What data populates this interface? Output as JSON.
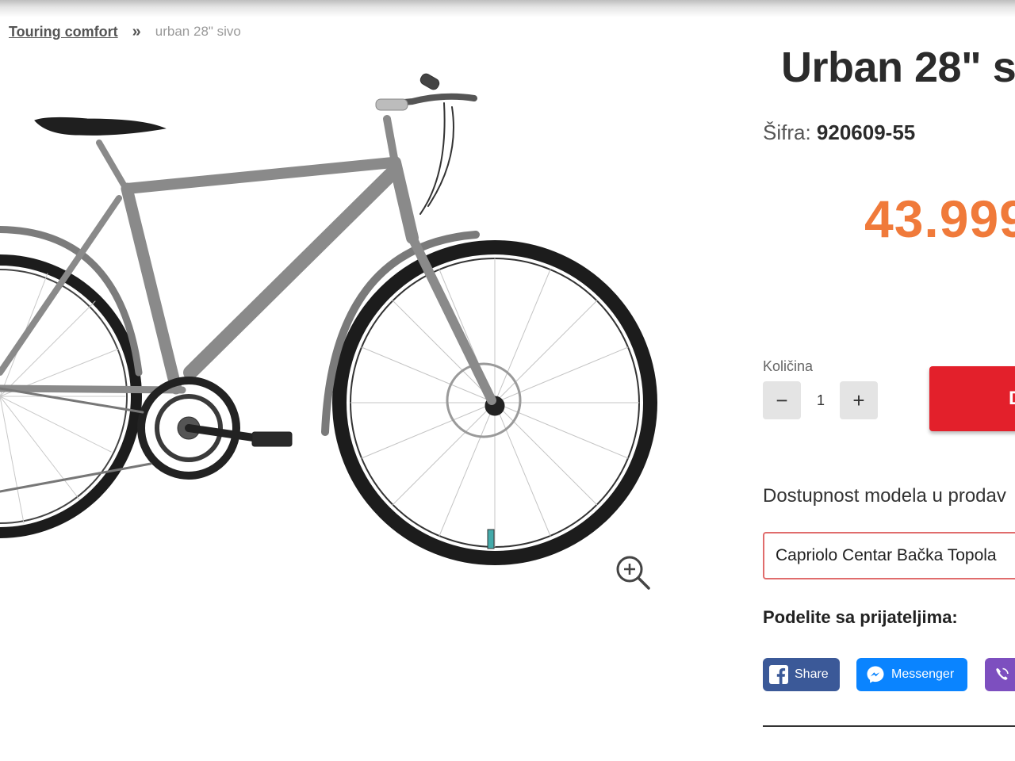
{
  "breadcrumb": {
    "parent": "Touring comfort",
    "separator": "»",
    "current": "urban 28\" sivo"
  },
  "product": {
    "title": "Urban 28\" s",
    "sku_label": "Šifra:",
    "sku_value": "920609-55",
    "price": "43.999",
    "image_alt": "bicycle-image"
  },
  "quantity": {
    "label": "Količina",
    "minus": "−",
    "value": "1",
    "plus": "+"
  },
  "cart": {
    "button_label": "D"
  },
  "availability": {
    "label": "Dostupnost modela u prodav",
    "selected_store": "Capriolo Centar Bačka Topola"
  },
  "share": {
    "heading": "Podelite sa prijateljima:",
    "facebook": "Share",
    "messenger": "Messenger",
    "viber": "V"
  },
  "colors": {
    "price": "#f07a3a",
    "cart_button": "#e3202b",
    "facebook": "#3b5998",
    "messenger": "#0a84ff",
    "viber": "#7d4fbf",
    "frame": "#8a8a8a"
  }
}
